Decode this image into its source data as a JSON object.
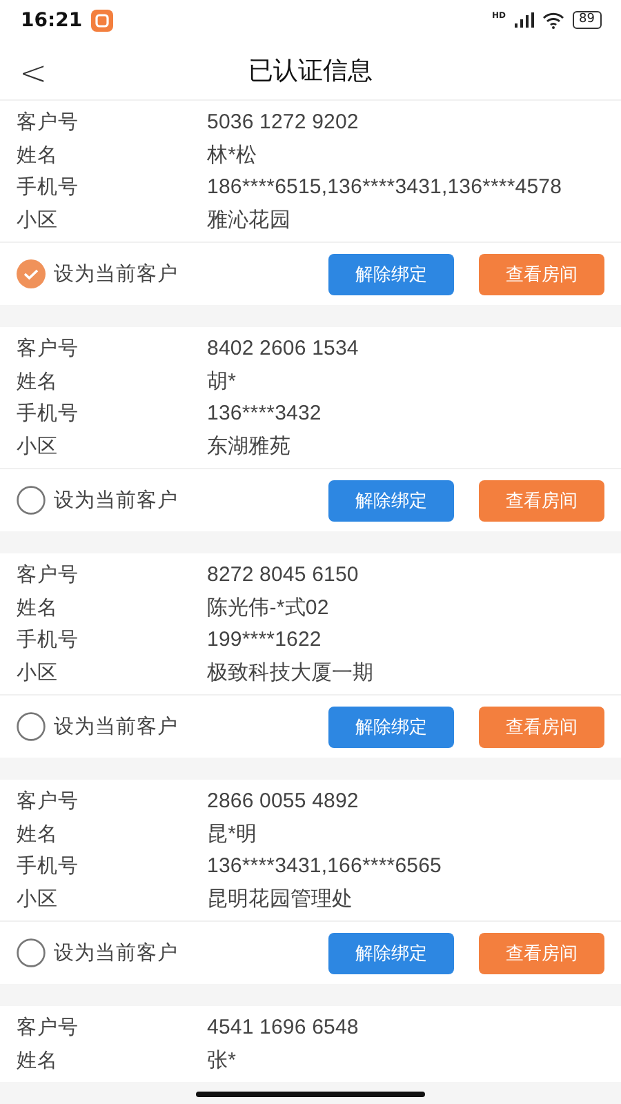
{
  "status_bar": {
    "time": "16:21",
    "network_label": "HD",
    "battery": "89"
  },
  "nav": {
    "back": "<",
    "title": "已认证信息"
  },
  "customers": [
    {
      "fields": [
        {
          "label": "客户号",
          "value": "5036 1272 9202"
        },
        {
          "label": "姓名",
          "value": "林*松"
        },
        {
          "label": "手机号",
          "value": "186****6515,136****3431,136****4578"
        },
        {
          "label": "小区",
          "value": "雅沁花园"
        }
      ],
      "current": {
        "label": "设为当前客户",
        "selected": true
      },
      "buttons": [
        {
          "label": "解除绑定",
          "kind": "unbind"
        },
        {
          "label": "查看房间",
          "kind": "rooms"
        }
      ]
    },
    {
      "fields": [
        {
          "label": "客户号",
          "value": "8402 2606 1534"
        },
        {
          "label": "姓名",
          "value": "胡*"
        },
        {
          "label": "手机号",
          "value": "136****3432"
        },
        {
          "label": "小区",
          "value": "东湖雅苑"
        }
      ],
      "current": {
        "label": "设为当前客户",
        "selected": false
      },
      "buttons": [
        {
          "label": "解除绑定",
          "kind": "unbind"
        },
        {
          "label": "查看房间",
          "kind": "rooms"
        }
      ]
    },
    {
      "fields": [
        {
          "label": "客户号",
          "value": "8272 8045 6150"
        },
        {
          "label": "姓名",
          "value": "陈光伟-*式02"
        },
        {
          "label": "手机号",
          "value": "199****1622"
        },
        {
          "label": "小区",
          "value": "极致科技大厦一期"
        }
      ],
      "current": {
        "label": "设为当前客户",
        "selected": false
      },
      "buttons": [
        {
          "label": "解除绑定",
          "kind": "unbind"
        },
        {
          "label": "查看房间",
          "kind": "rooms"
        }
      ]
    },
    {
      "fields": [
        {
          "label": "客户号",
          "value": "2866 0055 4892"
        },
        {
          "label": "姓名",
          "value": "昆*明"
        },
        {
          "label": "手机号",
          "value": "136****3431,166****6565"
        },
        {
          "label": "小区",
          "value": "昆明花园管理处"
        }
      ],
      "current": {
        "label": "设为当前客户",
        "selected": false
      },
      "buttons": [
        {
          "label": "解除绑定",
          "kind": "unbind"
        },
        {
          "label": "查看房间",
          "kind": "rooms"
        }
      ]
    },
    {
      "fields": [
        {
          "label": "客户号",
          "value": "4541 1696 6548"
        },
        {
          "label": "姓名",
          "value": "张*"
        }
      ]
    }
  ]
}
